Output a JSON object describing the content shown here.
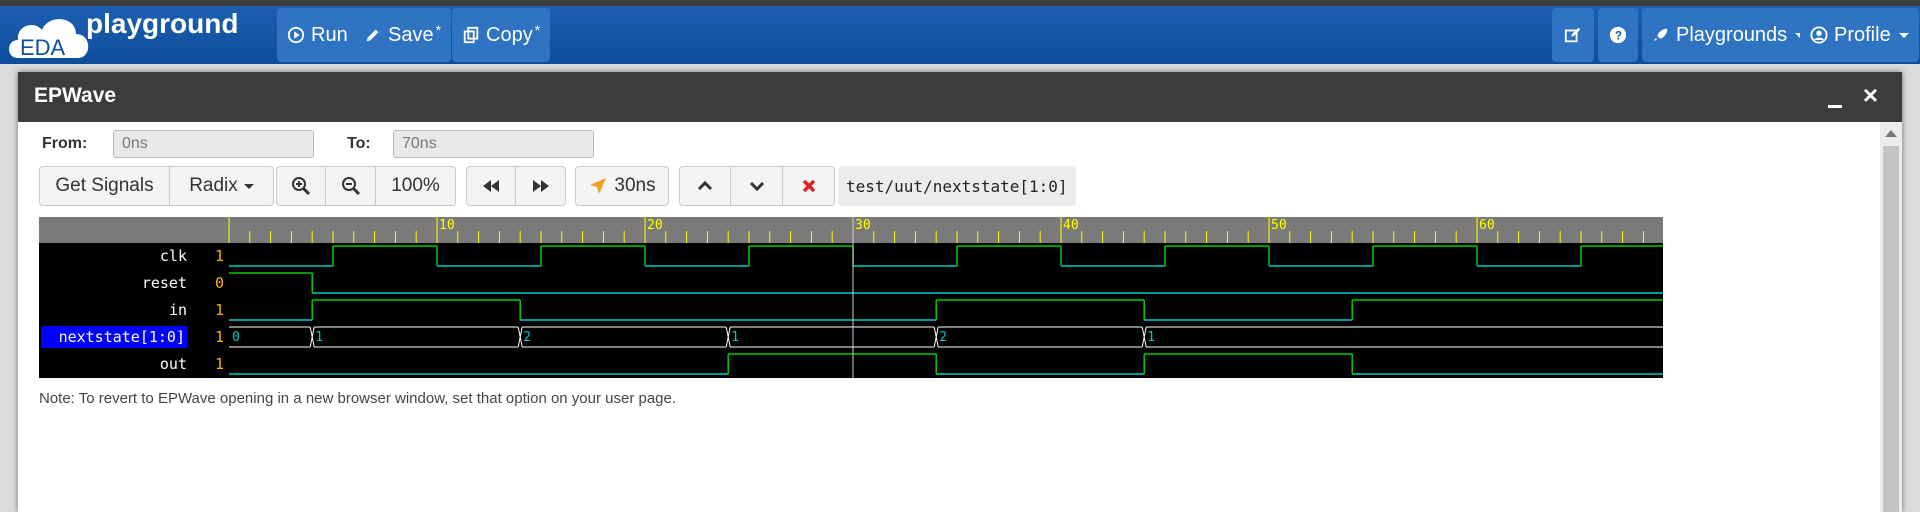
{
  "navbar": {
    "logo_text": "EDA",
    "brand": "playground",
    "run_label": "Run",
    "save_label": "Save",
    "copy_label": "Copy",
    "modified_marker": "*",
    "playgrounds_label": "Playgrounds",
    "profile_label": "Profile"
  },
  "modal": {
    "title": "EPWave",
    "close_glyph": "×"
  },
  "toolbar": {
    "from_label": "From:",
    "from_value": "0ns",
    "to_label": "To:",
    "to_value": "70ns",
    "get_signals": "Get Signals",
    "radix": "Radix",
    "zoom": "100%",
    "cursor_time": "30ns",
    "selected_path": "test/uut/nextstate[1:0]"
  },
  "waveform": {
    "time_range_ns": [
      0,
      70
    ],
    "tick_labels": [
      "10",
      "20",
      "30",
      "40",
      "50",
      "60"
    ],
    "cursor_ns": 30,
    "signals": [
      {
        "name": "clk",
        "value": "1",
        "type": "bit",
        "transitions": [
          [
            0,
            0
          ],
          [
            5,
            1
          ],
          [
            10,
            0
          ],
          [
            15,
            1
          ],
          [
            20,
            0
          ],
          [
            25,
            1
          ],
          [
            30,
            0
          ],
          [
            35,
            1
          ],
          [
            40,
            0
          ],
          [
            45,
            1
          ],
          [
            50,
            0
          ],
          [
            55,
            1
          ],
          [
            60,
            0
          ],
          [
            65,
            1
          ]
        ]
      },
      {
        "name": "reset",
        "value": "0",
        "type": "bit",
        "transitions": [
          [
            0,
            1
          ],
          [
            4,
            0
          ]
        ]
      },
      {
        "name": "in",
        "value": "1",
        "type": "bit",
        "transitions": [
          [
            0,
            0
          ],
          [
            4,
            1
          ],
          [
            14,
            0
          ],
          [
            34,
            1
          ],
          [
            44,
            0
          ],
          [
            54,
            1
          ]
        ]
      },
      {
        "name": "nextstate[1:0]",
        "value": "1",
        "type": "bus",
        "selected": true,
        "segments": [
          [
            0,
            "0"
          ],
          [
            4,
            "1"
          ],
          [
            14,
            "2"
          ],
          [
            24,
            "1"
          ],
          [
            34,
            "2"
          ],
          [
            44,
            "1"
          ]
        ]
      },
      {
        "name": "out",
        "value": "1",
        "type": "bit",
        "transitions": [
          [
            0,
            0
          ],
          [
            24,
            1
          ],
          [
            34,
            0
          ],
          [
            44,
            1
          ],
          [
            54,
            0
          ]
        ]
      }
    ],
    "colors": {
      "high": "#00cc00",
      "low": "#00cccc",
      "bus": "#ffffff",
      "cursor": "#ffff00"
    }
  },
  "note": "Note: To revert to EPWave opening in a new browser window, set that option on your user page."
}
